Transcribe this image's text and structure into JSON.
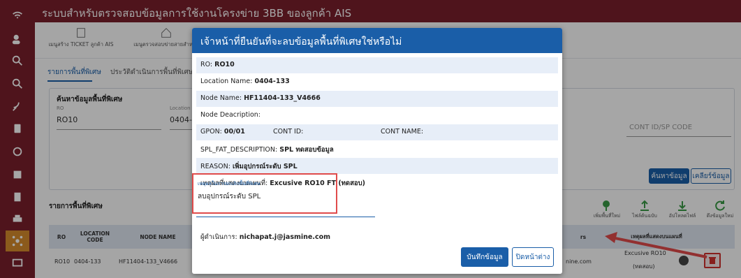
{
  "app": {
    "title": "ระบบสำหรับตรวจสอบข้อมูลการใช้งานโครงข่าย 3BB ของลูกค้า AIS"
  },
  "menu": [
    {
      "label": "เมนูสร้าง TICKET ลูกค้า AIS"
    },
    {
      "label": "เมนูตรวจสอบข่ายสายสำหรับ"
    }
  ],
  "tabs": [
    "รายการพื้นที่พิเศษ",
    "ประวัติดำเนินการพื้นที่พิเศษ"
  ],
  "search": {
    "title": "ค้นหาข้อมูลพื้นที่พิเศษ",
    "ro_label": "RO",
    "ro_value": "RO10",
    "location_label": "Location",
    "location_value": "0404-",
    "cont_placeholder": "CONT ID/SP CODE",
    "search_button": "ค้นหาข้อมูล",
    "clear_button": "เคลียร์ข้อมูล"
  },
  "list": {
    "title": "รายการพื้นที่พิเศษ",
    "actions": [
      "เพิ่มพื้นที่ใหม่",
      "ไฟล์ต้นฉบับ",
      "อัปโหลดไฟล์",
      "ดึงข้อมูลใหม่"
    ],
    "columns": [
      "RO",
      "LOCATION CODE",
      "NODE NAME",
      "rs",
      "เหตุผลที่แสดงบนแผนที่"
    ],
    "row": {
      "ro": "RO10",
      "location": "0404-133",
      "node": "HF11404-133_V4666",
      "email_tail": "nine.com",
      "map_reason": "Excusive RO10",
      "map_reason2": "(ทดสอบ)"
    }
  },
  "modal": {
    "title": "เจ้าหน้าที่ยืนยันที่จะลบข้อมูลพื้นที่พิเศษใช่หรือไม่",
    "ro_label": "RO:",
    "ro_value": "RO10",
    "location_label": "Location Name:",
    "location_value": "0404-133",
    "node_label": "Node Name:",
    "node_value": "HF11404-133_V4666",
    "node_desc_label": "Node Deacription:",
    "gpon_label": "GPON:",
    "gpon_value": "00/01",
    "cont_id_label": "CONT ID:",
    "cont_name_label": "CONT NAME:",
    "fat_label": "SPL_FAT_DESCRIPTION:",
    "fat_value": "SPL ทดสอบข้อมูล",
    "reason_label": "REASON:",
    "reason_value": "เพิ่มอุปกรณ์ระดับ SPL",
    "map_label": "เหตุผลที่แสดงบนแผนที่:",
    "map_value": "Excusive RO10 FT (ทดสอบ)",
    "cancel_reason_label": "เหตุผลในการยกเลิกพื้นที่พิเศษ",
    "cancel_reason_value": "ลบอุปกรณ์ระดับ SPL",
    "operator_label": "ผู้ดำเนินการ:",
    "operator_value": "nichapat.j@jasmine.com",
    "save_button": "บันทึกข้อมูล",
    "close_button": "ปิดหน้าต่าง"
  },
  "colors": {
    "brand": "#7a1f2b",
    "primary": "#1a5ea8",
    "highlight": "#e04b4b"
  }
}
